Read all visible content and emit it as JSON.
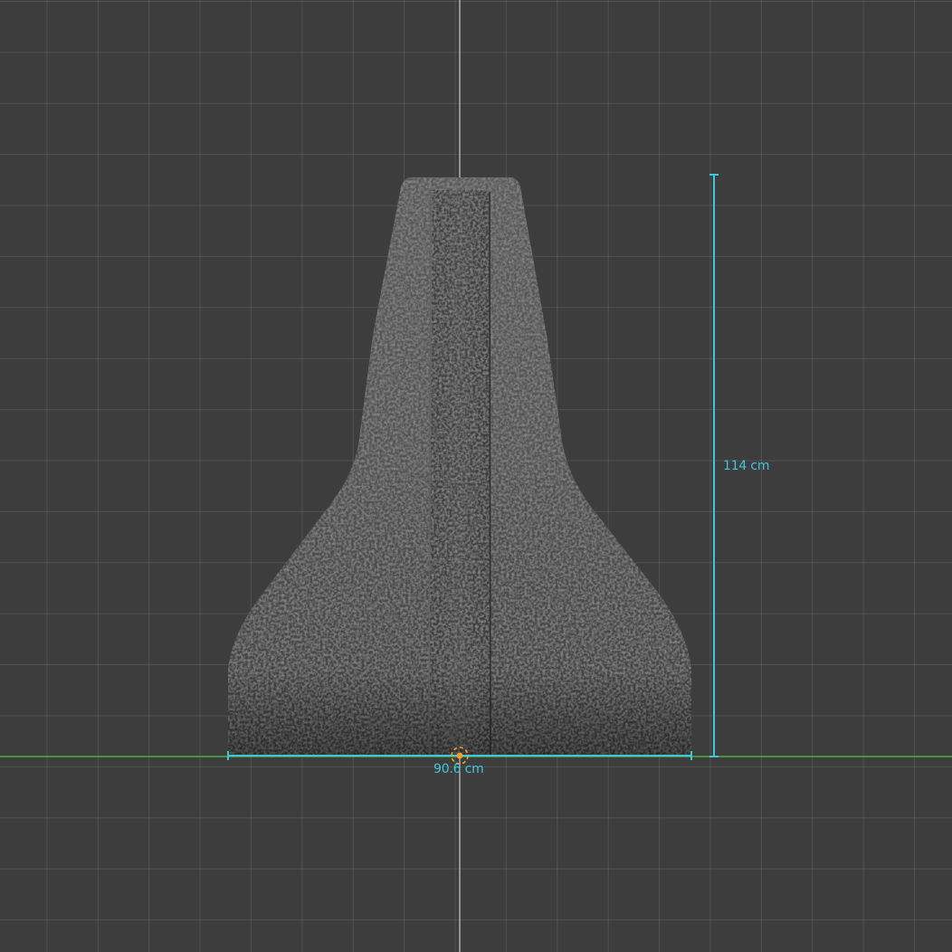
{
  "viewport": {
    "view": "front-orthographic",
    "grid": true,
    "colors": {
      "background": "#3d3d3d",
      "grid": "#4f4f4f",
      "x_axis": "#4caf3f",
      "z_axis": "#c8c8d0",
      "dimension": "#3fc6dc",
      "origin": "#f0a030"
    }
  },
  "object": {
    "type": "concrete-jersey-barrier",
    "material": "rough-concrete"
  },
  "dimensions": {
    "height_label": "114 cm",
    "width_label": "90.6 cm"
  },
  "origin_marker": {
    "icon": "origin-pivot-icon"
  }
}
